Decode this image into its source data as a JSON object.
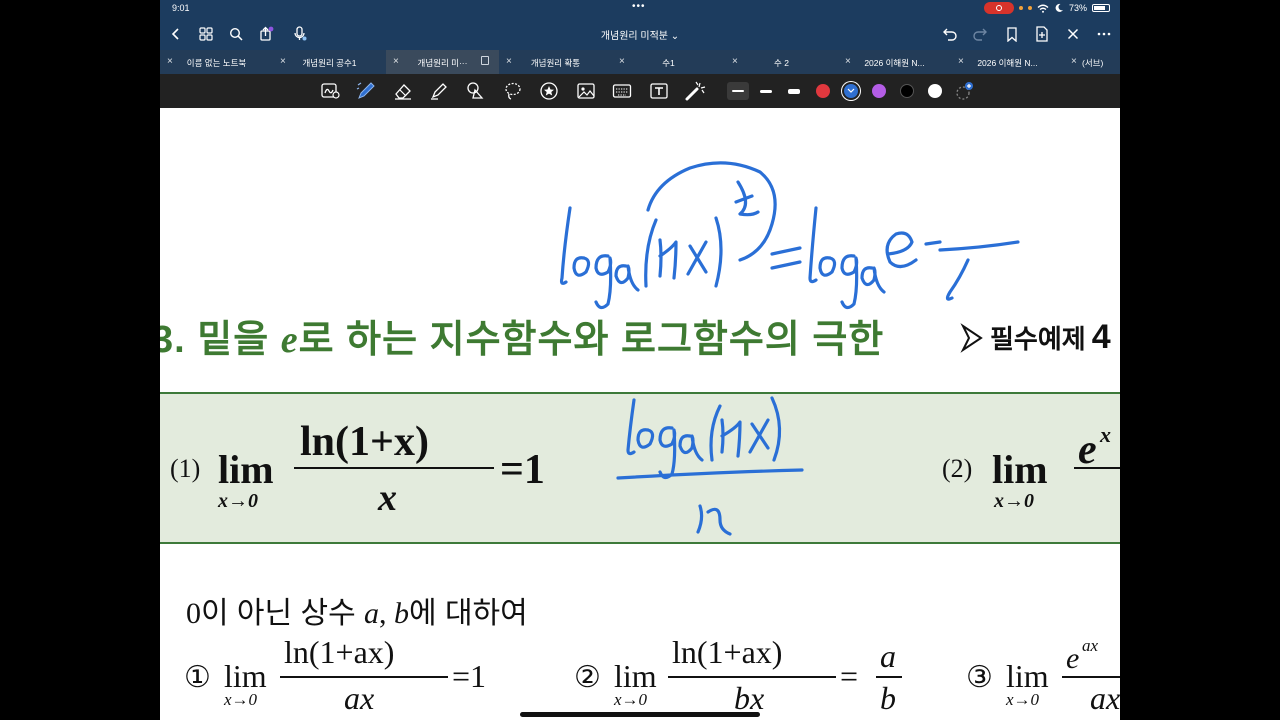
{
  "status": {
    "time": "9:01",
    "battery": "73%"
  },
  "nav": {
    "title": "개념원리 미적분 ⌄"
  },
  "tabs": [
    {
      "label": "이름 없는 노트북",
      "active": false
    },
    {
      "label": "개념원리 공수1",
      "active": false
    },
    {
      "label": "개념원리 미··· ",
      "active": true
    },
    {
      "label": "개념원리 확통",
      "active": false
    },
    {
      "label": "수1",
      "active": false
    },
    {
      "label": "수 2",
      "active": false
    },
    {
      "label": "2026 이해원 N...",
      "active": false
    },
    {
      "label": "2026 이해원 N...",
      "active": false
    },
    {
      "label": "(서브)",
      "active": false
    }
  ],
  "tools": [
    "lasso-ai",
    "pen",
    "eraser",
    "highlighter",
    "shapes",
    "lasso",
    "sticker",
    "image",
    "keyboard",
    "text",
    "laser"
  ],
  "colors": {
    "red": "#e0383e",
    "blue": "#2f6fd0",
    "purple": "#b45de6",
    "black": "#000000",
    "white": "#ffffff",
    "heading_green": "#3e7a32",
    "box_fill": "#e3ebdd"
  },
  "page": {
    "heading_prefix": "3.",
    "heading_part1": "밑을 ",
    "heading_var": "e",
    "heading_part2": "로 하는 지수함수와 로그함수의 극한",
    "example_label": "필수예제",
    "example_num": "4",
    "f1": {
      "label": "(1)",
      "lim": "lim",
      "sub": "x→0",
      "numerator": "ln(1+x)",
      "denominator": "x",
      "rhs": "=1"
    },
    "f2": {
      "label": "(2)",
      "lim": "lim",
      "sub": "x→0",
      "numerator_partial": "e",
      "sup": "x"
    },
    "intro_num": "0",
    "intro_text1": "이 아닌 상수 ",
    "intro_a": "a",
    "intro_comma": ", ",
    "intro_b": "b",
    "intro_text2": "에 대하여",
    "g1": {
      "label": "①",
      "lim": "lim",
      "sub": "x→0",
      "numerator": "ln(1+ax)",
      "denominator": "ax",
      "rhs": "=1"
    },
    "g2": {
      "label": "②",
      "lim": "lim",
      "sub": "x→0",
      "numerator": "ln(1+ax)",
      "denominator": "bx",
      "rhs": "=",
      "rhs_num": "a",
      "rhs_den": "b"
    },
    "g3": {
      "label": "③",
      "lim": "lim",
      "sub": "x→0",
      "numerator_partial": "e",
      "sup": "ax",
      "denominator_partial": "ax"
    }
  }
}
